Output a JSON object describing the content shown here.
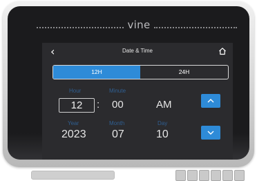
{
  "brand": {
    "logo_text": "vine"
  },
  "header": {
    "title": "Date & Time",
    "back_glyph": "‹",
    "back_icon": "chevron-left-icon",
    "home_icon": "home-icon"
  },
  "format_toggle": {
    "options": [
      "12H",
      "24H"
    ],
    "selected": "12H"
  },
  "time": {
    "hour_label": "Hour",
    "hour": "12",
    "separator": ":",
    "minute_label": "Minute",
    "minute": "00",
    "period": "AM"
  },
  "date": {
    "year_label": "Year",
    "year": "2023",
    "month_label": "Month",
    "month": "07",
    "day_label": "Day",
    "day": "10"
  },
  "controls": {
    "up_icon": "chevron-up-icon",
    "down_icon": "chevron-down-icon"
  },
  "colors": {
    "accent": "#2e8bd8",
    "screen_bg": "#2b2b2e",
    "label": "#2f5f92",
    "bezel": "#1b1b1d"
  }
}
